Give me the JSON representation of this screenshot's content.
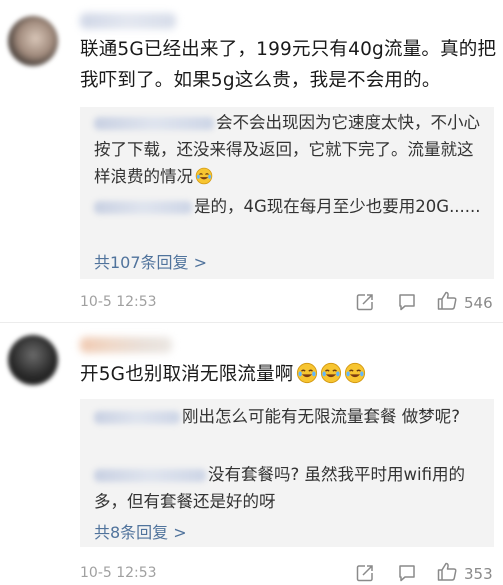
{
  "comments": [
    {
      "text": "联通5G已经出来了，199元只有40g流量。真的把我吓到了。如果5g这么贵，我是不会用的。",
      "replies": [
        {
          "text": "会不会出现因为它速度太快，不小心按了下载，还没来得及返回，它就下完了。流量就这样浪费的情况",
          "emoji": "laugh-cry-emoji"
        },
        {
          "text": "是的，4G现在每月至少也要用20G......"
        }
      ],
      "more_replies": "共107条回复 >",
      "time": "10-5 12:53",
      "likes": "546"
    },
    {
      "text": "开5G也别取消无限流量啊",
      "emojis": [
        "laugh-cry-emoji",
        "laugh-cry-emoji",
        "laugh-cry-emoji"
      ],
      "replies": [
        {
          "text": "刚出怎么可能有无限流量套餐 做梦呢?"
        },
        {
          "text": "没有套餐吗? 虽然我平时用wifi用的多，但有套餐还是好的呀"
        }
      ],
      "more_replies": "共8条回复 >",
      "time": "10-5 12:53",
      "likes": "353"
    }
  ],
  "colors": {
    "link": "#50739c",
    "reply_bg": "#f3f3f3",
    "meta": "#a0a0a0"
  }
}
